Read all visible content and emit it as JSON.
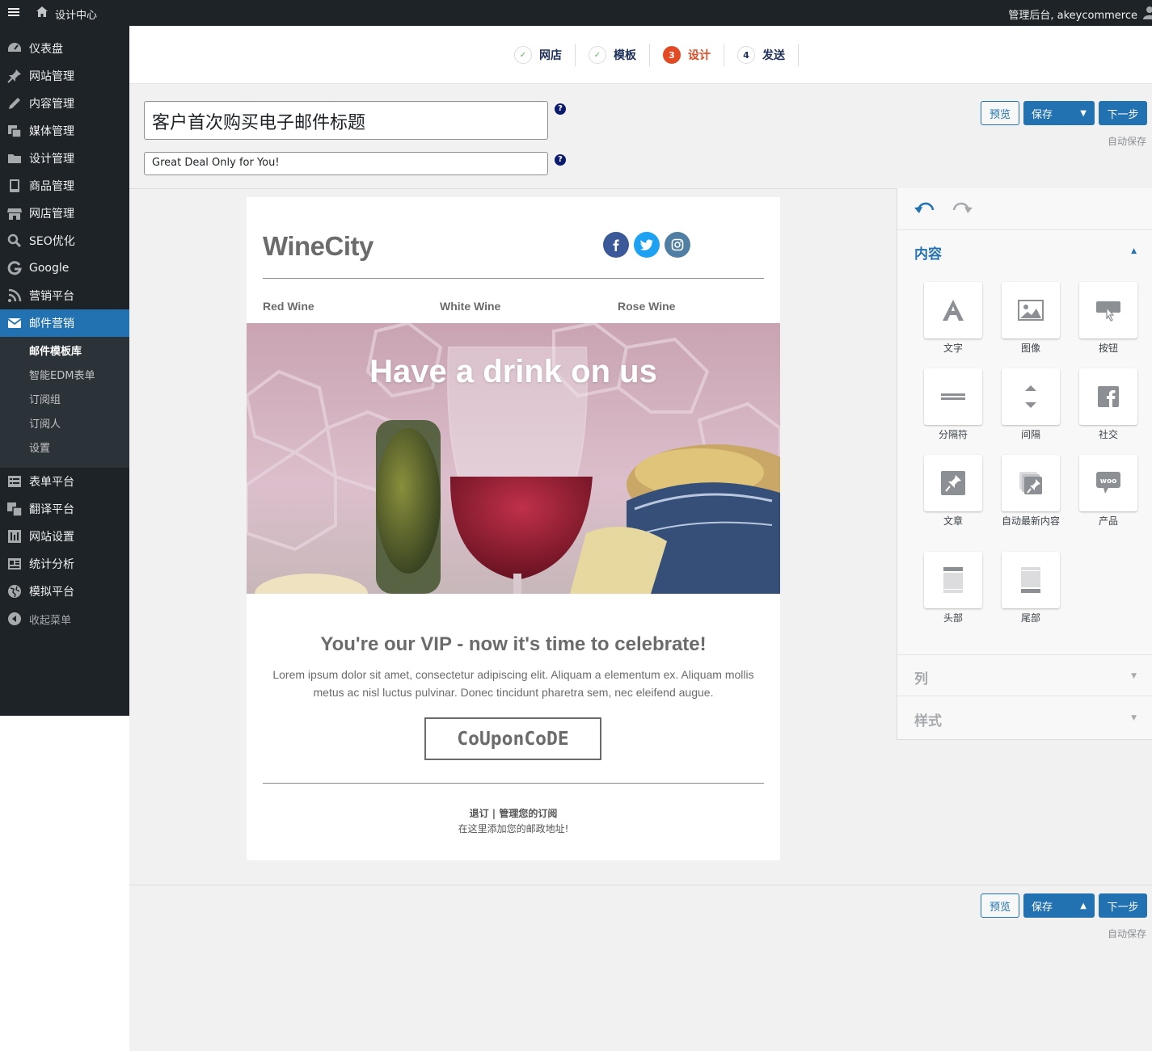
{
  "adminbar": {
    "site_name": "设计中心",
    "account": "管理后台, akeycommerce"
  },
  "sidebar": {
    "items": [
      {
        "label": "仪表盘",
        "icon": "dashboard-icon"
      },
      {
        "label": "网站管理",
        "icon": "pin-icon"
      },
      {
        "label": "内容管理",
        "icon": "pencil-icon"
      },
      {
        "label": "媒体管理",
        "icon": "media-icon"
      },
      {
        "label": "设计管理",
        "icon": "folder-icon"
      },
      {
        "label": "商品管理",
        "icon": "book-icon"
      },
      {
        "label": "网店管理",
        "icon": "store-icon"
      },
      {
        "label": "SEO优化",
        "icon": "search-icon"
      },
      {
        "label": "Google",
        "icon": "google-icon"
      },
      {
        "label": "营销平台",
        "icon": "rss-icon"
      },
      {
        "label": "邮件营销",
        "icon": "email-icon"
      }
    ],
    "submenu": [
      "邮件模板库",
      "智能EDM表单",
      "订阅组",
      "订阅人",
      "设置"
    ],
    "items_after": [
      {
        "label": "表单平台",
        "icon": "form-icon"
      },
      {
        "label": "翻译平台",
        "icon": "translate-icon"
      },
      {
        "label": "网站设置",
        "icon": "settings-icon"
      },
      {
        "label": "统计分析",
        "icon": "analytics-icon"
      },
      {
        "label": "模拟平台",
        "icon": "globe-icon"
      }
    ],
    "collapse_label": "收起菜单"
  },
  "wizard": {
    "steps": [
      {
        "num": "✓",
        "label": "网店",
        "state": "done"
      },
      {
        "num": "✓",
        "label": "模板",
        "state": "done"
      },
      {
        "num": "3",
        "label": "设计",
        "state": "current"
      },
      {
        "num": "4",
        "label": "发送",
        "state": "todo"
      }
    ]
  },
  "form": {
    "subject_value": "客户首次购买电子邮件标题",
    "preheader_value": "Great Deal Only for You!",
    "help_glyph": "?"
  },
  "actions": {
    "preview": "预览",
    "save": "保存",
    "next": "下一步",
    "autosave": "自动保存"
  },
  "email": {
    "logo": "WineCity",
    "nav": [
      "Red Wine",
      "White Wine",
      "Rose Wine"
    ],
    "hero_title": "Have a drink on us",
    "headline": "You're our VIP - now it's time to celebrate!",
    "body_line1": "Lorem ipsum dolor sit amet, consectetur adipiscing elit. Aliquam a elementum ex. Aliquam mollis",
    "body_line2": "metus ac nisl luctus pulvinar. Donec tincidunt pharetra sem, nec eleifend augue.",
    "coupon": "CoUponCoDE",
    "footer_links": "退订 | 管理您的订阅",
    "footer_address": "在这里添加您的邮政地址!"
  },
  "panel": {
    "content_title": "内容",
    "columns_title": "列",
    "styles_title": "样式",
    "widgets": [
      {
        "label": "文字",
        "icon": "text-icon"
      },
      {
        "label": "图像",
        "icon": "image-icon"
      },
      {
        "label": "按钮",
        "icon": "button-icon"
      },
      {
        "label": "分隔符",
        "icon": "divider-icon"
      },
      {
        "label": "间隔",
        "icon": "spacer-icon"
      },
      {
        "label": "社交",
        "icon": "facebook-icon"
      },
      {
        "label": "文章",
        "icon": "post-icon"
      },
      {
        "label": "自动最新内容",
        "icon": "auto-posts-icon"
      },
      {
        "label": "产品",
        "icon": "woo-icon"
      },
      {
        "label": "头部",
        "icon": "header-icon"
      },
      {
        "label": "尾部",
        "icon": "footer-icon"
      }
    ]
  },
  "colors": {
    "adminbar_bg": "#1d2327",
    "accent": "#2271b1",
    "current_step": "#e24a23",
    "facebook": "#3b5998",
    "twitter": "#1da1f2",
    "instagram": "#517fa4"
  }
}
